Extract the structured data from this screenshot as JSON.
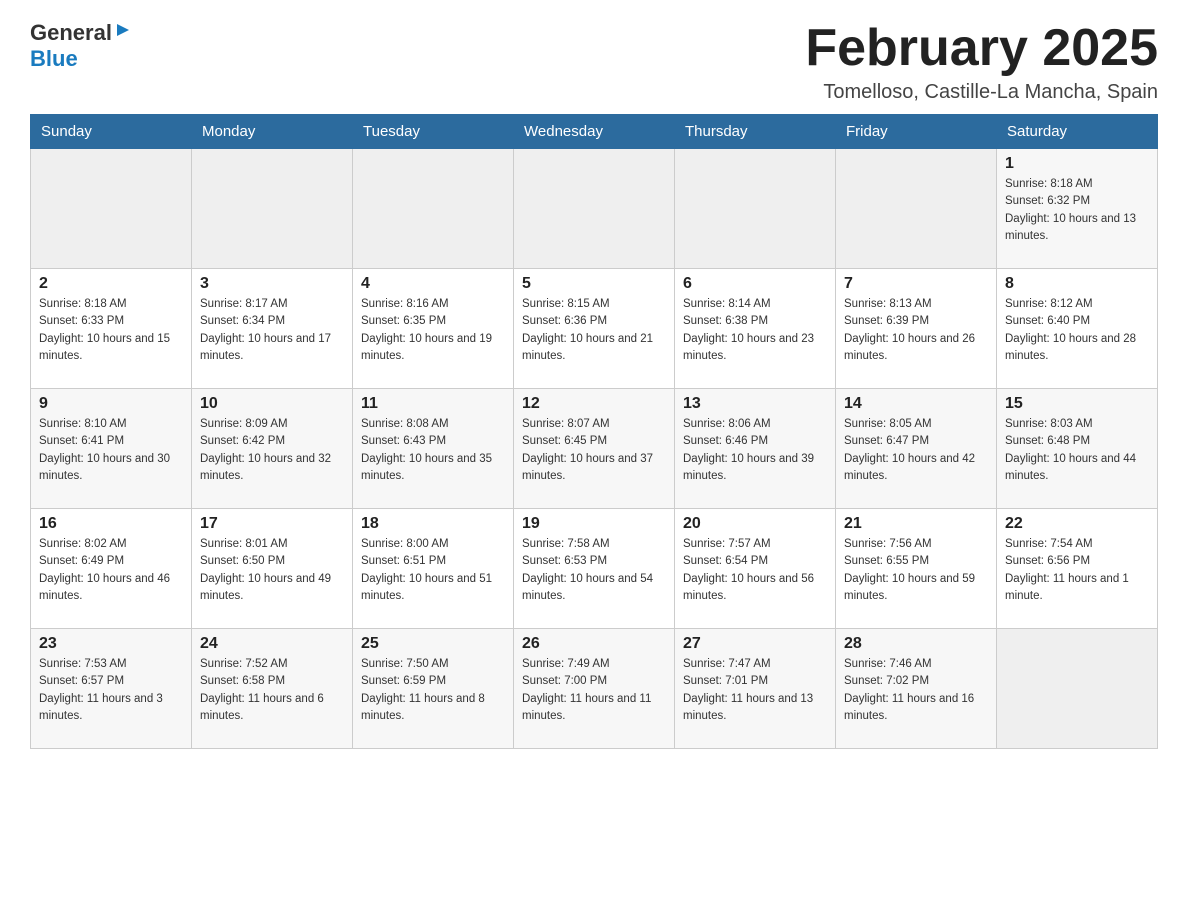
{
  "header": {
    "logo": {
      "general": "General",
      "arrow": "▶",
      "blue": "Blue"
    },
    "title": "February 2025",
    "location": "Tomelloso, Castille-La Mancha, Spain"
  },
  "calendar": {
    "days_of_week": [
      "Sunday",
      "Monday",
      "Tuesday",
      "Wednesday",
      "Thursday",
      "Friday",
      "Saturday"
    ],
    "weeks": [
      {
        "id": "week1",
        "days": [
          {
            "number": "",
            "info": ""
          },
          {
            "number": "",
            "info": ""
          },
          {
            "number": "",
            "info": ""
          },
          {
            "number": "",
            "info": ""
          },
          {
            "number": "",
            "info": ""
          },
          {
            "number": "",
            "info": ""
          },
          {
            "number": "1",
            "info": "Sunrise: 8:18 AM\nSunset: 6:32 PM\nDaylight: 10 hours and 13 minutes."
          }
        ]
      },
      {
        "id": "week2",
        "days": [
          {
            "number": "2",
            "info": "Sunrise: 8:18 AM\nSunset: 6:33 PM\nDaylight: 10 hours and 15 minutes."
          },
          {
            "number": "3",
            "info": "Sunrise: 8:17 AM\nSunset: 6:34 PM\nDaylight: 10 hours and 17 minutes."
          },
          {
            "number": "4",
            "info": "Sunrise: 8:16 AM\nSunset: 6:35 PM\nDaylight: 10 hours and 19 minutes."
          },
          {
            "number": "5",
            "info": "Sunrise: 8:15 AM\nSunset: 6:36 PM\nDaylight: 10 hours and 21 minutes."
          },
          {
            "number": "6",
            "info": "Sunrise: 8:14 AM\nSunset: 6:38 PM\nDaylight: 10 hours and 23 minutes."
          },
          {
            "number": "7",
            "info": "Sunrise: 8:13 AM\nSunset: 6:39 PM\nDaylight: 10 hours and 26 minutes."
          },
          {
            "number": "8",
            "info": "Sunrise: 8:12 AM\nSunset: 6:40 PM\nDaylight: 10 hours and 28 minutes."
          }
        ]
      },
      {
        "id": "week3",
        "days": [
          {
            "number": "9",
            "info": "Sunrise: 8:10 AM\nSunset: 6:41 PM\nDaylight: 10 hours and 30 minutes."
          },
          {
            "number": "10",
            "info": "Sunrise: 8:09 AM\nSunset: 6:42 PM\nDaylight: 10 hours and 32 minutes."
          },
          {
            "number": "11",
            "info": "Sunrise: 8:08 AM\nSunset: 6:43 PM\nDaylight: 10 hours and 35 minutes."
          },
          {
            "number": "12",
            "info": "Sunrise: 8:07 AM\nSunset: 6:45 PM\nDaylight: 10 hours and 37 minutes."
          },
          {
            "number": "13",
            "info": "Sunrise: 8:06 AM\nSunset: 6:46 PM\nDaylight: 10 hours and 39 minutes."
          },
          {
            "number": "14",
            "info": "Sunrise: 8:05 AM\nSunset: 6:47 PM\nDaylight: 10 hours and 42 minutes."
          },
          {
            "number": "15",
            "info": "Sunrise: 8:03 AM\nSunset: 6:48 PM\nDaylight: 10 hours and 44 minutes."
          }
        ]
      },
      {
        "id": "week4",
        "days": [
          {
            "number": "16",
            "info": "Sunrise: 8:02 AM\nSunset: 6:49 PM\nDaylight: 10 hours and 46 minutes."
          },
          {
            "number": "17",
            "info": "Sunrise: 8:01 AM\nSunset: 6:50 PM\nDaylight: 10 hours and 49 minutes."
          },
          {
            "number": "18",
            "info": "Sunrise: 8:00 AM\nSunset: 6:51 PM\nDaylight: 10 hours and 51 minutes."
          },
          {
            "number": "19",
            "info": "Sunrise: 7:58 AM\nSunset: 6:53 PM\nDaylight: 10 hours and 54 minutes."
          },
          {
            "number": "20",
            "info": "Sunrise: 7:57 AM\nSunset: 6:54 PM\nDaylight: 10 hours and 56 minutes."
          },
          {
            "number": "21",
            "info": "Sunrise: 7:56 AM\nSunset: 6:55 PM\nDaylight: 10 hours and 59 minutes."
          },
          {
            "number": "22",
            "info": "Sunrise: 7:54 AM\nSunset: 6:56 PM\nDaylight: 11 hours and 1 minute."
          }
        ]
      },
      {
        "id": "week5",
        "days": [
          {
            "number": "23",
            "info": "Sunrise: 7:53 AM\nSunset: 6:57 PM\nDaylight: 11 hours and 3 minutes."
          },
          {
            "number": "24",
            "info": "Sunrise: 7:52 AM\nSunset: 6:58 PM\nDaylight: 11 hours and 6 minutes."
          },
          {
            "number": "25",
            "info": "Sunrise: 7:50 AM\nSunset: 6:59 PM\nDaylight: 11 hours and 8 minutes."
          },
          {
            "number": "26",
            "info": "Sunrise: 7:49 AM\nSunset: 7:00 PM\nDaylight: 11 hours and 11 minutes."
          },
          {
            "number": "27",
            "info": "Sunrise: 7:47 AM\nSunset: 7:01 PM\nDaylight: 11 hours and 13 minutes."
          },
          {
            "number": "28",
            "info": "Sunrise: 7:46 AM\nSunset: 7:02 PM\nDaylight: 11 hours and 16 minutes."
          },
          {
            "number": "",
            "info": ""
          }
        ]
      }
    ]
  }
}
